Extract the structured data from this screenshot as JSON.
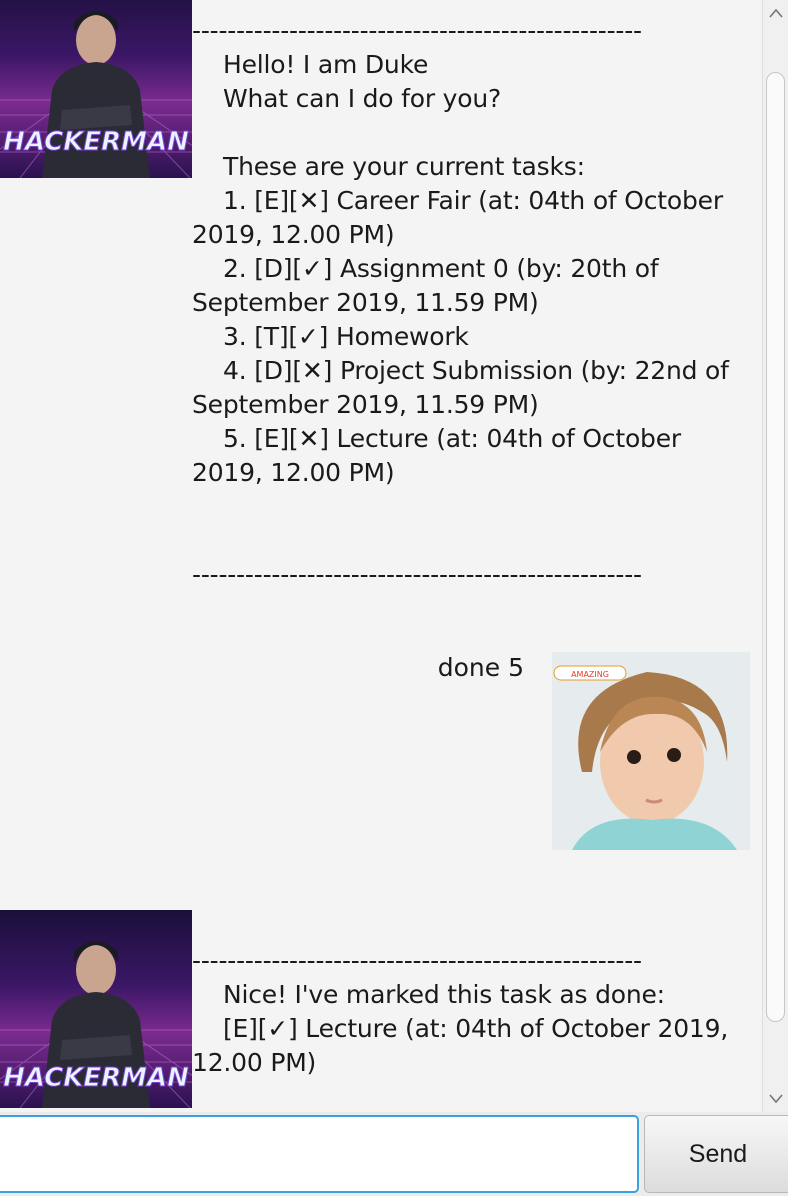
{
  "dialog": {
    "duke_greeting": "---------------------------------------------------\n    Hello! I am Duke\n    What can I do for you?\n\n    These are your current tasks:\n    1. [E][✕] Career Fair (at: 04th of October 2019, 12.00 PM)\n    2. [D][✓] Assignment 0 (by: 20th of September 2019, 11.59 PM)\n    3. [T][✓] Homework\n    4. [D][✕] Project Submission (by: 22nd of September 2019, 11.59 PM)\n    5. [E][✕] Lecture (at: 04th of October 2019, 12.00 PM)\n\n\n---------------------------------------------------",
    "user_message": "done 5",
    "duke_reply": "---------------------------------------------------\n    Nice! I've marked this task as done:\n    [E][✓] Lecture (at: 04th of October 2019, 12.00 PM)",
    "duke_avatar_caption": "HACKERMAN",
    "user_avatar_caption": "AMAZING"
  },
  "input": {
    "value": "",
    "placeholder": ""
  },
  "send_button": {
    "label": "Send"
  },
  "colors": {
    "background": "#f4f4f4",
    "input_focus": "#3aa0e0",
    "avatar_duke_bg": "#3b1766",
    "avatar_duke_text": "#e8f4ff"
  }
}
